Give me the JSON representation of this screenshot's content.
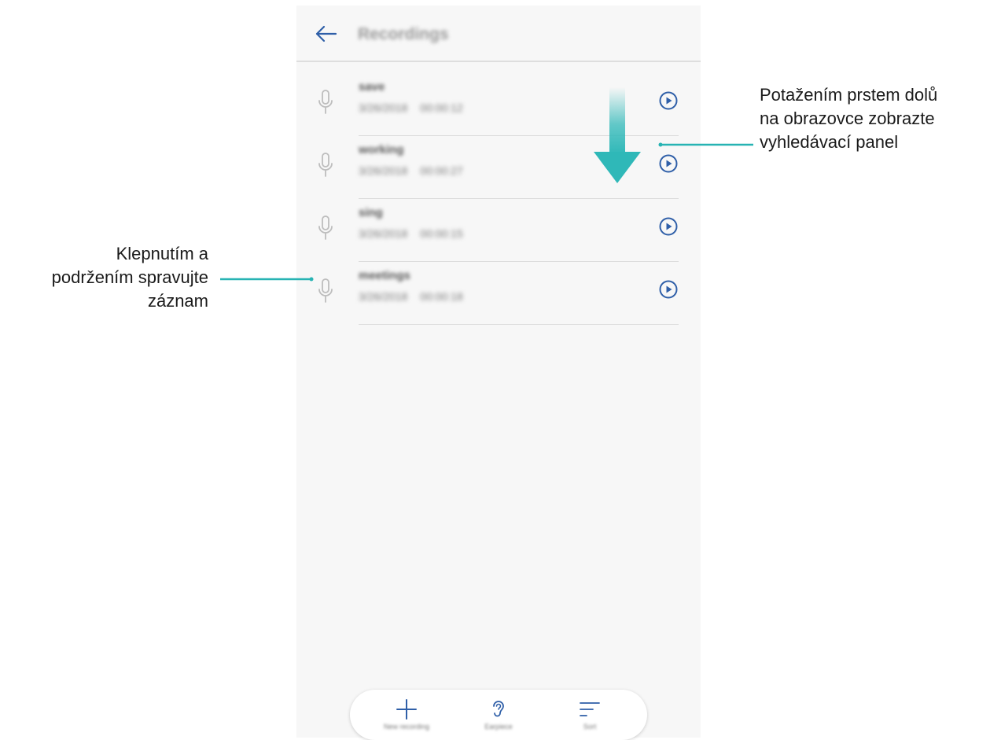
{
  "header": {
    "title": "Recordings"
  },
  "recordings": [
    {
      "name": "save",
      "date": "3/26/2018",
      "duration": "00:00:12"
    },
    {
      "name": "working",
      "date": "3/26/2018",
      "duration": "00:00:27"
    },
    {
      "name": "sing",
      "date": "3/26/2018",
      "duration": "00:00:15"
    },
    {
      "name": "meetings",
      "date": "3/26/2018",
      "duration": "00:00:18"
    }
  ],
  "toolbar": {
    "new_recording": "New recording",
    "earpiece": "Earpiece",
    "sort": "Sort"
  },
  "annotations": {
    "right_lines": [
      "Potažením prstem dolů",
      "na obrazovce zobrazte",
      "vyhledávací panel"
    ],
    "left_lines": [
      "Klepnutím a",
      "podržením spravujte",
      "záznam"
    ]
  },
  "colors": {
    "accent": "#2f5fa8",
    "callout_line": "#27b3b3",
    "icon_gray": "#bdbdbd"
  }
}
